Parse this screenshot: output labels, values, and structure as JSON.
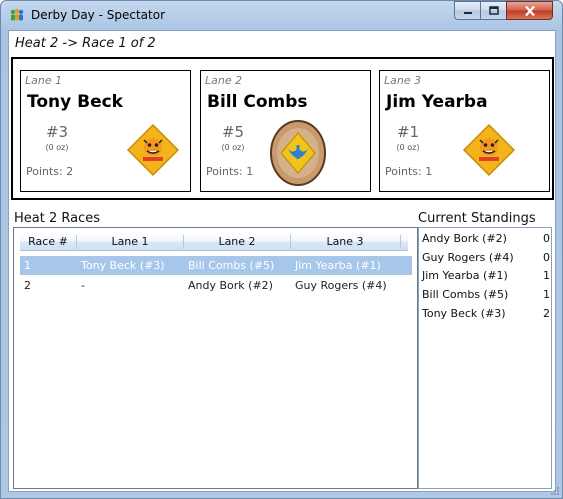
{
  "window": {
    "title": "Derby Day - Spectator",
    "controls": [
      "minimize",
      "maximize",
      "close"
    ]
  },
  "heat": {
    "title": "Heat 2 -> Race 1 of 2"
  },
  "lanes": [
    {
      "label": "Lane 1",
      "racer": "Tony Beck",
      "car_number": "#3",
      "weight": "(0 oz)",
      "points": "Points: 2",
      "badge_icon": "tiger-cub-badge-icon"
    },
    {
      "label": "Lane 2",
      "racer": "Bill Combs",
      "car_number": "#5",
      "weight": "(0 oz)",
      "points": "Points: 1",
      "badge_icon": "webelos-badge-icon"
    },
    {
      "label": "Lane 3",
      "racer": "Jim Yearba",
      "car_number": "#1",
      "weight": "(0 oz)",
      "points": "Points: 1",
      "badge_icon": "tiger-cub-badge-icon"
    }
  ],
  "races": {
    "title": "Heat 2 Races",
    "columns": [
      "Race #",
      "Lane 1",
      "Lane 2",
      "Lane 3"
    ],
    "rows": [
      {
        "race": "1",
        "lane1": "Tony Beck (#3)",
        "lane2": "Bill Combs (#5)",
        "lane3": "Jim Yearba (#1)",
        "selected": true
      },
      {
        "race": "2",
        "lane1": "-",
        "lane2": "Andy Bork (#2)",
        "lane3": "Guy Rogers (#4)",
        "selected": false
      }
    ]
  },
  "standings": {
    "title": "Current Standings",
    "rows": [
      {
        "name": "Andy Bork (#2)",
        "points": "0"
      },
      {
        "name": "Guy Rogers (#4)",
        "points": "0"
      },
      {
        "name": "Jim Yearba (#1)",
        "points": "1"
      },
      {
        "name": "Bill Combs (#5)",
        "points": "1"
      },
      {
        "name": "Tony Beck (#3)",
        "points": "2"
      }
    ]
  },
  "colors": {
    "selection": "#a6c7ea",
    "badge_gold": "#f2b418",
    "badge_blue": "#2f7fd1"
  }
}
